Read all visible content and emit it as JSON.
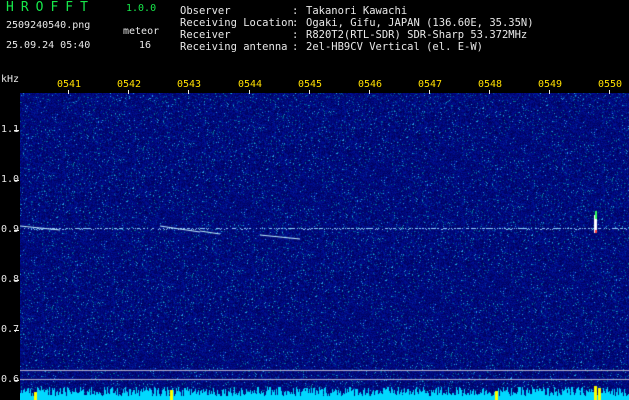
{
  "app": {
    "title": "HROFFT",
    "version": "1.0.0"
  },
  "capture": {
    "filename": "2509240540.png",
    "timestamp": "25.09.24 05:40",
    "meteor_label": "meteor",
    "meteor_count": "16"
  },
  "info": [
    {
      "label": "Observer",
      "value": "Takanori Kawachi"
    },
    {
      "label": "Receiving Location",
      "value": "Ogaki, Gifu, JAPAN (136.60E, 35.35N)"
    },
    {
      "label": "Receiver",
      "value": "R820T2(RTL-SDR) SDR-Sharp 53.372MHz"
    },
    {
      "label": "Receiving antenna",
      "value": "2el-HB9CV Vertical (el. E-W)"
    }
  ],
  "axis": {
    "unit": "kHz",
    "time_labels": [
      "0541",
      "0542",
      "0543",
      "0544",
      "0545",
      "0546",
      "0547",
      "0548",
      "0549",
      "0550"
    ],
    "freq_labels": [
      "1.1",
      "1.0",
      "0.9",
      "0.8",
      "0.7",
      "0.6"
    ]
  },
  "colors": {
    "title_green": "#16e84a",
    "time_label_yellow": "#ffe000",
    "background_blue": "#00007a",
    "noise_cyan": "#00e0ff"
  }
}
